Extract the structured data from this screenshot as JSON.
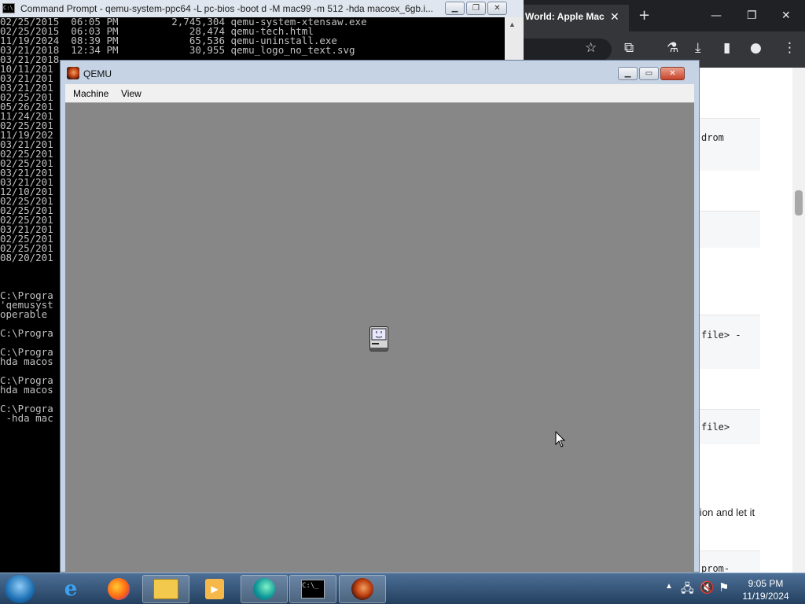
{
  "cmd": {
    "title": "Command Prompt - qemu-system-ppc64  -L pc-bios -boot d -M mac99 -m 512 -hda macosx_6gb.i...",
    "lines": [
      "02/25/2015  06:05 PM         2,745,304 qemu-system-xtensaw.exe",
      "02/25/2015  06:03 PM            28,474 qemu-tech.html",
      "11/19/2024  08:39 PM            65,536 qemu-uninstall.exe",
      "03/21/2018  12:34 PM            30,955 qemu_logo_no_text.svg",
      "03/21/2018",
      "10/11/201",
      "03/21/201",
      "03/21/201",
      "02/25/201",
      "05/26/201",
      "11/24/201",
      "02/25/201",
      "11/19/202",
      "03/21/201",
      "02/25/201",
      "02/25/201",
      "03/21/201",
      "03/21/201",
      "12/10/201",
      "02/25/201",
      "02/25/201",
      "02/25/201",
      "03/21/201",
      "02/25/201",
      "02/25/201",
      "08/20/201",
      "",
      "",
      "",
      "C:\\Progra",
      "'qemusyst",
      "operable",
      "",
      "C:\\Progra",
      "",
      "C:\\Progra",
      "hda macos",
      "",
      "C:\\Progra",
      "hda macos",
      "",
      "C:\\Progra",
      " -hda mac"
    ]
  },
  "browser": {
    "tab_title": "World: Apple Mac",
    "tab_close": "✕",
    "new_tab": "+",
    "snippets": {
      "s1": "drom",
      "s2": "file> -",
      "s3": "file>",
      "s5": "prom-"
    },
    "text": "ion and let it"
  },
  "qemu": {
    "title": "QEMU",
    "menu": {
      "machine": "Machine",
      "view": "View"
    }
  },
  "taskbar": {
    "time": "9:05 PM",
    "date": "11/19/2024",
    "apps": [
      "internet-explorer",
      "firefox",
      "file-explorer",
      "media-player",
      "edge",
      "command-prompt",
      "qemu"
    ]
  },
  "colors": {
    "qemu_screen": "#878787",
    "console_bg": "#000000",
    "console_text": "#c0c0c0"
  }
}
